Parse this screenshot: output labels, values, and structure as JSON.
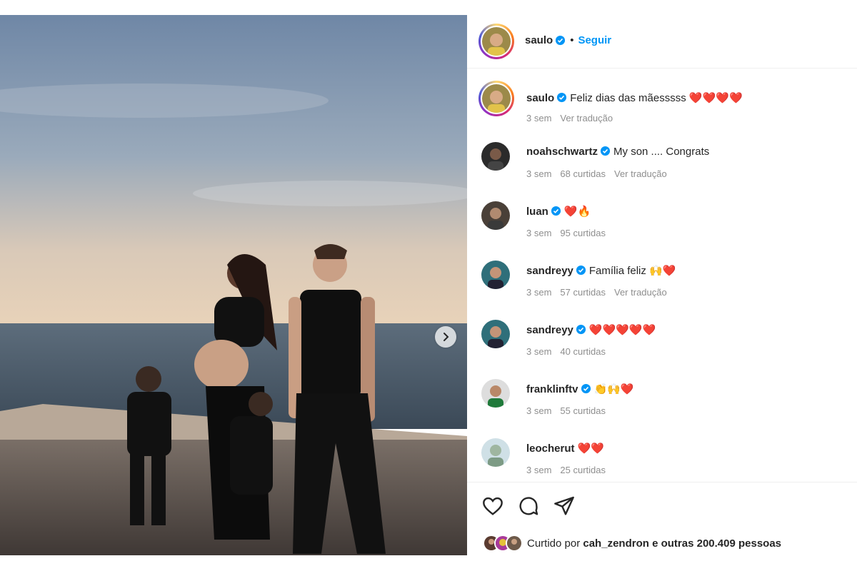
{
  "post_author": {
    "username": "saulo",
    "follow_label": "Seguir",
    "separator": "•"
  },
  "comments": [
    {
      "username": "saulo",
      "text": "Feliz dias das mãesssss ❤️❤️❤️❤️",
      "time": "3 sem",
      "likes": "",
      "translate": "Ver tradução"
    },
    {
      "username": "noahschwartz",
      "text": "My son .... Congrats",
      "time": "3 sem",
      "likes": "68 curtidas",
      "translate": "Ver tradução"
    },
    {
      "username": "luan",
      "text": "❤️🔥",
      "time": "3 sem",
      "likes": "95 curtidas",
      "translate": ""
    },
    {
      "username": "sandreyy",
      "text": "Família feliz 🙌❤️",
      "time": "3 sem",
      "likes": "57 curtidas",
      "translate": "Ver tradução"
    },
    {
      "username": "sandreyy",
      "text": "❤️❤️❤️❤️❤️",
      "time": "3 sem",
      "likes": "40 curtidas",
      "translate": ""
    },
    {
      "username": "franklinftv",
      "text": "👏🙌❤️",
      "time": "3 sem",
      "likes": "55 curtidas",
      "translate": ""
    },
    {
      "username": "leocherut",
      "text": "❤️❤️",
      "time": "3 sem",
      "likes": "25 curtidas",
      "translate": ""
    }
  ],
  "liked_by": {
    "prefix": "Curtido por",
    "user": "cah_zendron",
    "suffix": "e outras 200.409 pessoas"
  },
  "icons": {
    "like": "heart-icon",
    "comment": "comment-icon",
    "share": "send-icon",
    "next": "chevron-right-icon",
    "verified": "verified-badge-icon"
  },
  "colors": {
    "accent": "#0095f6",
    "verified": "#0095f6",
    "meta": "#8e8e8e",
    "text": "#262626"
  }
}
